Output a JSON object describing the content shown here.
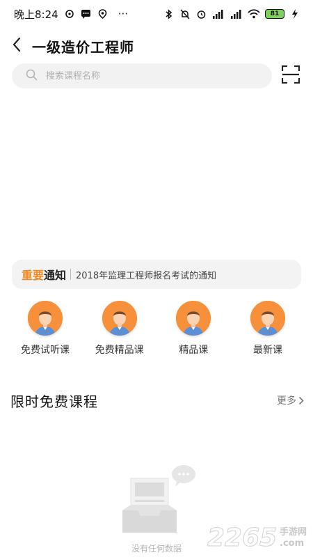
{
  "status_bar": {
    "time": "晚上8:24",
    "more": "···",
    "battery": "81"
  },
  "header": {
    "title": "一级造价工程师"
  },
  "search": {
    "placeholder": "搜索课程名称"
  },
  "notice": {
    "label_part1": "重要",
    "label_part2": "通知",
    "text": "2018年监理工程师报名考试的通知"
  },
  "categories": [
    {
      "label": "免费试听课"
    },
    {
      "label": "免费精品课"
    },
    {
      "label": "精品课"
    },
    {
      "label": "最新课"
    }
  ],
  "section": {
    "title": "限时免费课程",
    "more": "更多"
  },
  "empty": {
    "text": "没有任何数据"
  },
  "watermark": {
    "number": "2265",
    "cn": "手游网",
    "domain": ".com"
  },
  "colors": {
    "accent": "#f08a24",
    "avatar_bg": "#f7903a",
    "search_bg": "#f2f2f2",
    "notice_bg": "#f3f3f3"
  },
  "icons": {
    "back": "chevron-left-icon",
    "search": "search-icon",
    "scan": "scan-icon",
    "more_arrow": "chevron-right-icon"
  }
}
